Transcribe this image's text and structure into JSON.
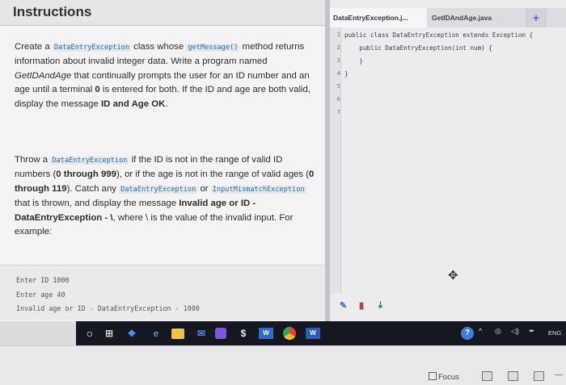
{
  "instructions": {
    "title": "Instructions",
    "p1": {
      "t1": "Create a ",
      "c1": "DataEntryException",
      "t2": " class whose ",
      "c2": "getMessage()",
      "t3": " method returns information about invalid integer data. Write a program named ",
      "e1": "GetIDAndAge",
      "t4": " that continually prompts the user for an ID number and an age until a terminal ",
      "b1": "0",
      "t5": " is entered for both. If the ID and age are both valid, display the message ",
      "b2": "ID and Age OK",
      "t6": "."
    },
    "p2": {
      "t1": "Throw a ",
      "c1": "DataEntryException",
      "t2": " if the ID is not in the range of valid ID numbers (",
      "b1": "0 through 999",
      "t3": "), or if the age is not in the range of valid ages (",
      "b2": "0 through 119",
      "t4": "). Catch any ",
      "c2": "DataEntryException",
      "t5": " or ",
      "c3": "InputMismatchException",
      "t6": " that is thrown, and display the message ",
      "b3": "Invalid age or ID - DataEntryException - \\",
      "t7": ", where \\ is the value of the invalid input. For example:"
    },
    "example": [
      "Enter ID 1000",
      "Enter age 40",
      "Invalid age or ID - DataEntryException - 1000"
    ]
  },
  "editor": {
    "tabs": [
      "DataEntryException.j...",
      "GetIDAndAge.java"
    ],
    "add_tab": "+",
    "line_numbers": [
      "1",
      "2",
      "3",
      "4",
      "5",
      "6",
      "7"
    ],
    "code": [
      "public class DataEntryException extends Exception {",
      "    public DataEntryException(int num) {",
      "    }",
      "}"
    ]
  },
  "taskbar": {
    "items": [
      "start-icon",
      "task-view-icon",
      "dropbox-icon",
      "edge-icon",
      "file-explorer-icon",
      "mail-icon",
      "teams-icon",
      "dollar-icon",
      "word-icon",
      "chrome-icon",
      "word-icon"
    ],
    "tray_help": "?",
    "language": "ENG"
  },
  "statusbar": {
    "focus_label": "Focus"
  }
}
